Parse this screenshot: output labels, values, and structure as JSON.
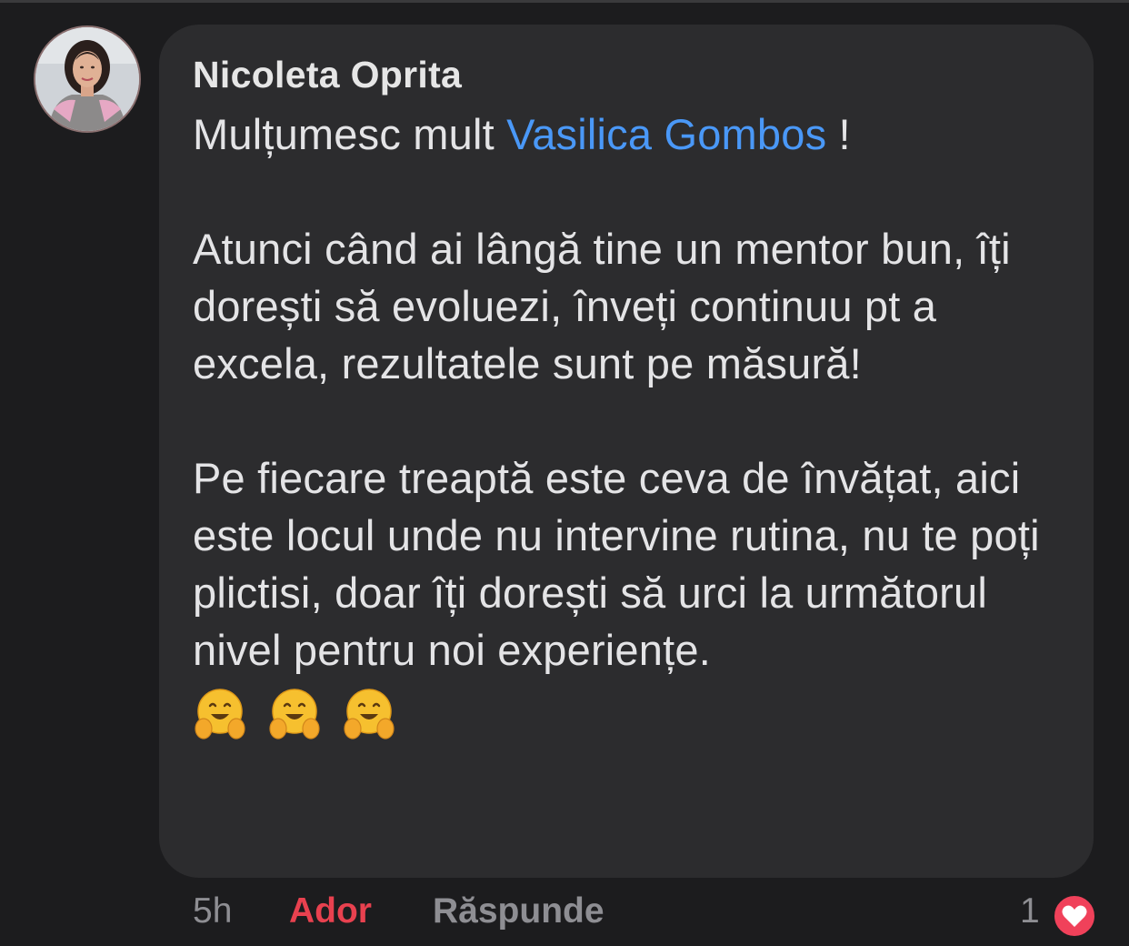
{
  "comment": {
    "author": "Nicoleta Oprita",
    "message_prefix": "Mulțumesc mult ",
    "mention": "Vasilica Gombos",
    "message_suffix": " !",
    "paragraph_1": "Atunci când ai lângă tine un mentor bun, îți dorești să evoluezi, înveți continuu pt a excela, rezultatele sunt pe măsură!",
    "paragraph_2": "Pe fiecare treaptă este ceva de învățat, aici este locul unde nu intervine rutina, nu te poți plictisi, doar îți dorești să urci la următorul nivel  pentru noi experiențe.",
    "emojis": [
      "hugging-face",
      "hugging-face",
      "hugging-face"
    ]
  },
  "actions": {
    "time": "5h",
    "like_label": "Ador",
    "reply_label": "Răspunde",
    "reaction_count": "1",
    "reaction_icon": "heart-icon"
  },
  "colors": {
    "background": "#1c1c1e",
    "bubble": "#2c2c2e",
    "mention": "#4a98f7",
    "like_active": "#e8414f",
    "heart_badge": "#f0415a"
  }
}
